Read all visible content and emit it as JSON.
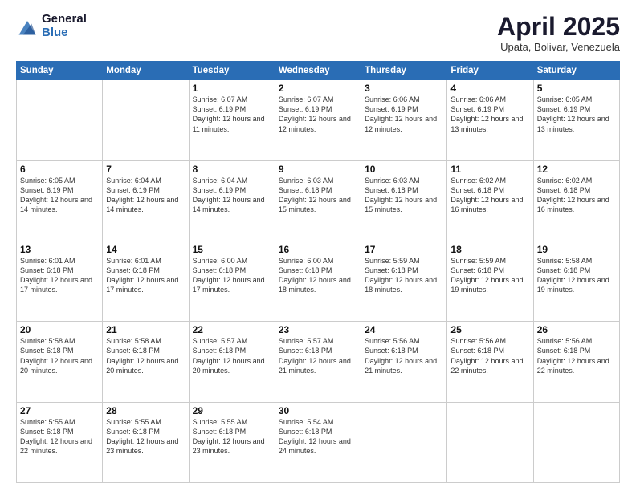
{
  "logo": {
    "general": "General",
    "blue": "Blue"
  },
  "title": {
    "month": "April 2025",
    "location": "Upata, Bolivar, Venezuela"
  },
  "weekdays": [
    "Sunday",
    "Monday",
    "Tuesday",
    "Wednesday",
    "Thursday",
    "Friday",
    "Saturday"
  ],
  "weeks": [
    [
      {
        "day": "",
        "info": ""
      },
      {
        "day": "",
        "info": ""
      },
      {
        "day": "1",
        "info": "Sunrise: 6:07 AM\nSunset: 6:19 PM\nDaylight: 12 hours and 11 minutes."
      },
      {
        "day": "2",
        "info": "Sunrise: 6:07 AM\nSunset: 6:19 PM\nDaylight: 12 hours and 12 minutes."
      },
      {
        "day": "3",
        "info": "Sunrise: 6:06 AM\nSunset: 6:19 PM\nDaylight: 12 hours and 12 minutes."
      },
      {
        "day": "4",
        "info": "Sunrise: 6:06 AM\nSunset: 6:19 PM\nDaylight: 12 hours and 13 minutes."
      },
      {
        "day": "5",
        "info": "Sunrise: 6:05 AM\nSunset: 6:19 PM\nDaylight: 12 hours and 13 minutes."
      }
    ],
    [
      {
        "day": "6",
        "info": "Sunrise: 6:05 AM\nSunset: 6:19 PM\nDaylight: 12 hours and 14 minutes."
      },
      {
        "day": "7",
        "info": "Sunrise: 6:04 AM\nSunset: 6:19 PM\nDaylight: 12 hours and 14 minutes."
      },
      {
        "day": "8",
        "info": "Sunrise: 6:04 AM\nSunset: 6:19 PM\nDaylight: 12 hours and 14 minutes."
      },
      {
        "day": "9",
        "info": "Sunrise: 6:03 AM\nSunset: 6:18 PM\nDaylight: 12 hours and 15 minutes."
      },
      {
        "day": "10",
        "info": "Sunrise: 6:03 AM\nSunset: 6:18 PM\nDaylight: 12 hours and 15 minutes."
      },
      {
        "day": "11",
        "info": "Sunrise: 6:02 AM\nSunset: 6:18 PM\nDaylight: 12 hours and 16 minutes."
      },
      {
        "day": "12",
        "info": "Sunrise: 6:02 AM\nSunset: 6:18 PM\nDaylight: 12 hours and 16 minutes."
      }
    ],
    [
      {
        "day": "13",
        "info": "Sunrise: 6:01 AM\nSunset: 6:18 PM\nDaylight: 12 hours and 17 minutes."
      },
      {
        "day": "14",
        "info": "Sunrise: 6:01 AM\nSunset: 6:18 PM\nDaylight: 12 hours and 17 minutes."
      },
      {
        "day": "15",
        "info": "Sunrise: 6:00 AM\nSunset: 6:18 PM\nDaylight: 12 hours and 17 minutes."
      },
      {
        "day": "16",
        "info": "Sunrise: 6:00 AM\nSunset: 6:18 PM\nDaylight: 12 hours and 18 minutes."
      },
      {
        "day": "17",
        "info": "Sunrise: 5:59 AM\nSunset: 6:18 PM\nDaylight: 12 hours and 18 minutes."
      },
      {
        "day": "18",
        "info": "Sunrise: 5:59 AM\nSunset: 6:18 PM\nDaylight: 12 hours and 19 minutes."
      },
      {
        "day": "19",
        "info": "Sunrise: 5:58 AM\nSunset: 6:18 PM\nDaylight: 12 hours and 19 minutes."
      }
    ],
    [
      {
        "day": "20",
        "info": "Sunrise: 5:58 AM\nSunset: 6:18 PM\nDaylight: 12 hours and 20 minutes."
      },
      {
        "day": "21",
        "info": "Sunrise: 5:58 AM\nSunset: 6:18 PM\nDaylight: 12 hours and 20 minutes."
      },
      {
        "day": "22",
        "info": "Sunrise: 5:57 AM\nSunset: 6:18 PM\nDaylight: 12 hours and 20 minutes."
      },
      {
        "day": "23",
        "info": "Sunrise: 5:57 AM\nSunset: 6:18 PM\nDaylight: 12 hours and 21 minutes."
      },
      {
        "day": "24",
        "info": "Sunrise: 5:56 AM\nSunset: 6:18 PM\nDaylight: 12 hours and 21 minutes."
      },
      {
        "day": "25",
        "info": "Sunrise: 5:56 AM\nSunset: 6:18 PM\nDaylight: 12 hours and 22 minutes."
      },
      {
        "day": "26",
        "info": "Sunrise: 5:56 AM\nSunset: 6:18 PM\nDaylight: 12 hours and 22 minutes."
      }
    ],
    [
      {
        "day": "27",
        "info": "Sunrise: 5:55 AM\nSunset: 6:18 PM\nDaylight: 12 hours and 22 minutes."
      },
      {
        "day": "28",
        "info": "Sunrise: 5:55 AM\nSunset: 6:18 PM\nDaylight: 12 hours and 23 minutes."
      },
      {
        "day": "29",
        "info": "Sunrise: 5:55 AM\nSunset: 6:18 PM\nDaylight: 12 hours and 23 minutes."
      },
      {
        "day": "30",
        "info": "Sunrise: 5:54 AM\nSunset: 6:18 PM\nDaylight: 12 hours and 24 minutes."
      },
      {
        "day": "",
        "info": ""
      },
      {
        "day": "",
        "info": ""
      },
      {
        "day": "",
        "info": ""
      }
    ]
  ]
}
